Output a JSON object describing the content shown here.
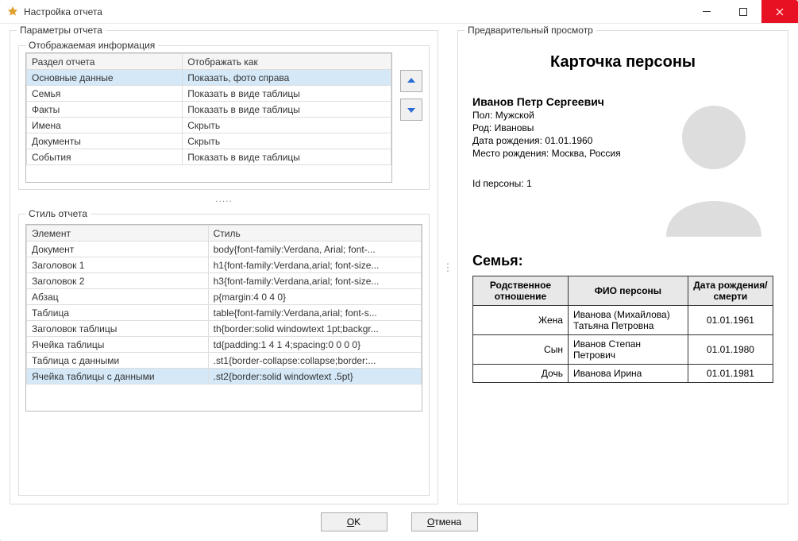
{
  "window": {
    "title": "Настройка отчета"
  },
  "params_title": "Параметры отчета",
  "display_info_title": "Отображаемая информация",
  "display_table": {
    "headers": [
      "Раздел отчета",
      "Отображать как"
    ],
    "rows": [
      {
        "section": "Основные данные",
        "display": "Показать, фото справа",
        "selected": true
      },
      {
        "section": "Семья",
        "display": "Показать в виде таблицы"
      },
      {
        "section": "Факты",
        "display": "Показать в виде таблицы"
      },
      {
        "section": "Имена",
        "display": "Скрыть"
      },
      {
        "section": "Документы",
        "display": "Скрыть"
      },
      {
        "section": "События",
        "display": "Показать в виде таблицы"
      }
    ]
  },
  "splitter": ".....",
  "style_title": "Стиль отчета",
  "style_table": {
    "headers": [
      "Элемент",
      "Стиль"
    ],
    "rows": [
      {
        "el": "Документ",
        "st": "body{font-family:Verdana, Arial; font-..."
      },
      {
        "el": "Заголовок 1",
        "st": "h1{font-family:Verdana,arial; font-size..."
      },
      {
        "el": "Заголовок 2",
        "st": "h3{font-family:Verdana,arial; font-size..."
      },
      {
        "el": "Абзац",
        "st": "p{margin:4 0 4 0}"
      },
      {
        "el": "Таблица",
        "st": "table{font-family:Verdana,arial; font-s..."
      },
      {
        "el": "Заголовок таблицы",
        "st": "th{border:solid windowtext 1pt;backgr..."
      },
      {
        "el": "Ячейка таблицы",
        "st": "td{padding:1 4 1 4;spacing:0 0 0 0}"
      },
      {
        "el": "Таблица с данными",
        "st": ".st1{border-collapse:collapse;border:..."
      },
      {
        "el": "Ячейка таблицы с данными",
        "st": ".st2{border:solid windowtext .5pt}",
        "selected": true
      }
    ]
  },
  "preview_title": "Предварительный просмотр",
  "preview": {
    "heading": "Карточка персоны",
    "name": "Иванов Петр Сергеевич",
    "gender_label": "Пол:",
    "gender": "Мужской",
    "clan_label": "Род:",
    "clan": "Ивановы",
    "dob_label": "Дата рождения:",
    "dob": "01.01.1960",
    "pob_label": "Место рождения:",
    "pob": "Москва, Россия",
    "id_label": "Id персоны:",
    "id": "1",
    "family_heading": "Семья:",
    "family_headers": [
      "Родственное отношение",
      "ФИО персоны",
      "Дата рождения/смерти"
    ],
    "family_rows": [
      {
        "rel": "Жена",
        "fio": "Иванова (Михайлова) Татьяна Петровна",
        "date": "01.01.1961"
      },
      {
        "rel": "Сын",
        "fio": "Иванов Степан Петрович",
        "date": "01.01.1980"
      },
      {
        "rel": "Дочь",
        "fio": "Иванова Ирина",
        "date": "01.01.1981"
      }
    ]
  },
  "buttons": {
    "ok": "OK",
    "cancel": "Отмена"
  }
}
